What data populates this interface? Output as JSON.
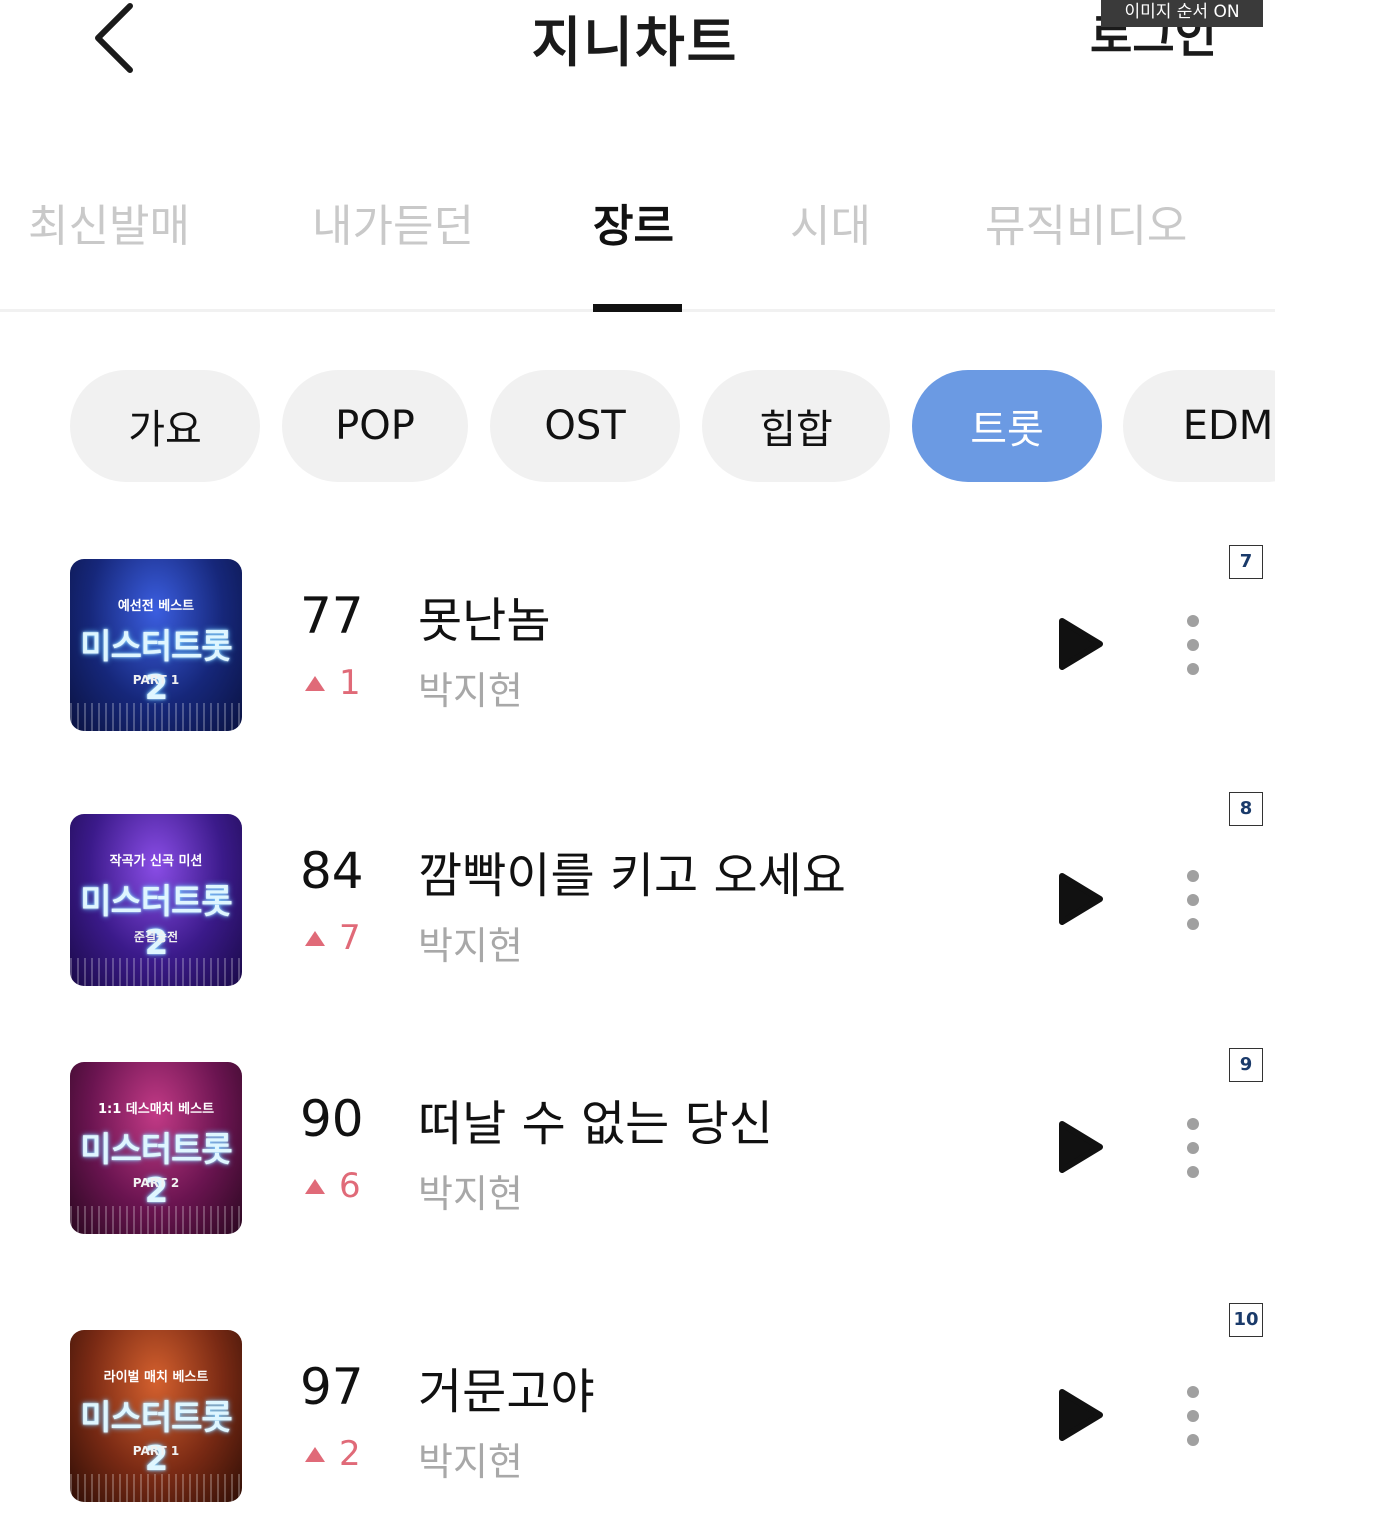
{
  "header": {
    "title": "지니차트",
    "login_label": "로그인",
    "image_order_badge": "이미지 순서 ON"
  },
  "tabs": [
    {
      "label": "최신발매",
      "active": false
    },
    {
      "label": "내가듣던",
      "active": false
    },
    {
      "label": "장르",
      "active": true
    },
    {
      "label": "시대",
      "active": false
    },
    {
      "label": "뮤직비디오",
      "active": false
    }
  ],
  "genres": [
    {
      "label": "가요",
      "active": false
    },
    {
      "label": "POP",
      "active": false
    },
    {
      "label": "OST",
      "active": false
    },
    {
      "label": "힙합",
      "active": false
    },
    {
      "label": "트롯",
      "active": true
    },
    {
      "label": "EDM",
      "active": false
    }
  ],
  "colors": {
    "accent": "#6b9ae3",
    "rank_up": "#e06a78",
    "tab_inactive": "#c9c9c9",
    "artist": "#a8a8a8"
  },
  "songs": [
    {
      "rank": "77",
      "change": "1",
      "title": "못난놈",
      "artist": "박지현",
      "index": "7",
      "album": {
        "subtitle": "예선전 베스트",
        "logo": "미스터트롯2",
        "part": "PART 1"
      }
    },
    {
      "rank": "84",
      "change": "7",
      "title": "깜빡이를 키고 오세요",
      "artist": "박지현",
      "index": "8",
      "album": {
        "subtitle": "작곡가 신곡 미션",
        "logo": "미스터트롯2",
        "part": "준결승전"
      }
    },
    {
      "rank": "90",
      "change": "6",
      "title": "떠날 수 없는 당신",
      "artist": "박지현",
      "index": "9",
      "album": {
        "subtitle": "1:1 데스매치 베스트",
        "logo": "미스터트롯2",
        "part": "PART 2"
      }
    },
    {
      "rank": "97",
      "change": "2",
      "title": "거문고야",
      "artist": "박지현",
      "index": "10",
      "album": {
        "subtitle": "라이벌 매치 베스트",
        "logo": "미스터트롯2",
        "part": "PART 1"
      }
    }
  ]
}
